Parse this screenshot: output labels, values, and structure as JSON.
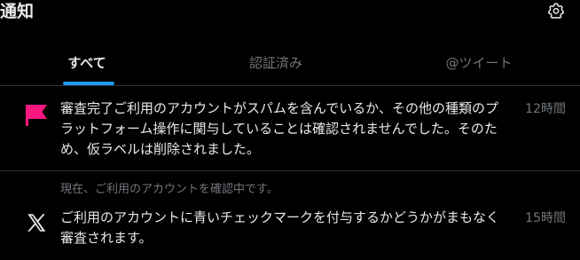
{
  "header": {
    "title": "通知",
    "settings_icon": "gear-icon"
  },
  "tabs": [
    {
      "label": "すべて",
      "active": true
    },
    {
      "label": "認証済み",
      "active": false
    },
    {
      "label": "@ツイート",
      "active": false
    }
  ],
  "notifications": [
    {
      "icon": "flag-icon",
      "icon_color": "#f91880",
      "text": "審査完了ご利用のアカウントがスパムを含んでいるか、その他の種類のプラットフォーム操作に関与していることは確認されませんでした。そのため、仮ラベルは削除されました。",
      "time": "12時間"
    },
    {
      "icon": "x-logo-icon",
      "subtext": "現在、ご利用のアカウントを確認中です。",
      "text": "ご利用のアカウントに青いチェックマークを付与するかどうかがまもなく審査されます。",
      "time": "15時間"
    }
  ],
  "colors": {
    "background": "#000000",
    "accent": "#1d9bf0",
    "divider": "#2f3336",
    "muted": "#71767b",
    "text": "#e7e9ea"
  }
}
